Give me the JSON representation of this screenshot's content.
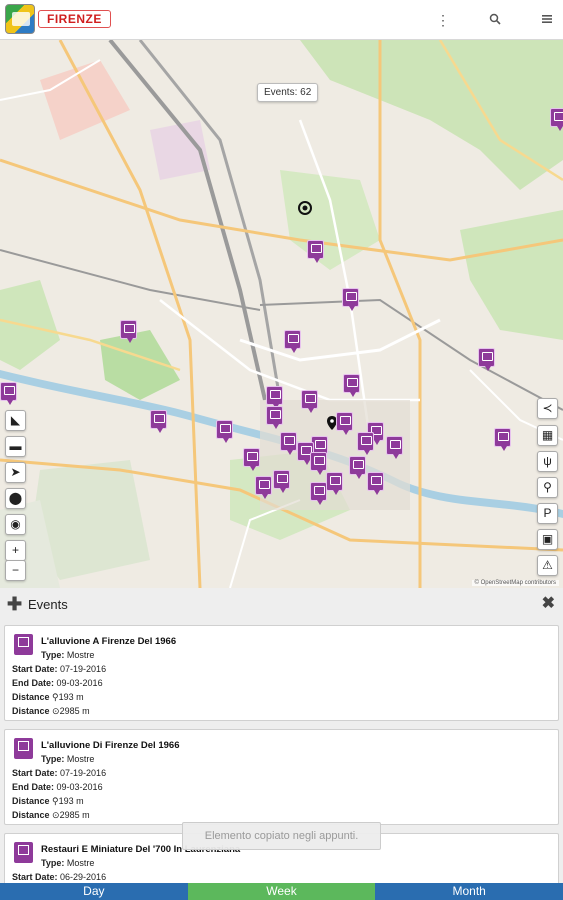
{
  "header": {
    "city": "FIRENZE",
    "icons": [
      "menu-dots-icon",
      "search-icon",
      "list-icon"
    ]
  },
  "map": {
    "events_label": "Events: 62",
    "attribution": "© OpenStreetMap contributors",
    "zoom_in": "+",
    "zoom_out": "−"
  },
  "panel": {
    "title": "Events",
    "cards": [
      {
        "title": "L'alluvione A Firenze Del 1966",
        "type_label": "Type:",
        "type": "Mostre",
        "start_label": "Start Date:",
        "start": "07-19-2016",
        "end_label": "End Date:",
        "end": "09-03-2016",
        "dist1_label": "Distance",
        "dist1": "193 m",
        "dist2_label": "Distance",
        "dist2": "2985 m"
      },
      {
        "title": "L'alluvione Di Firenze Del 1966",
        "type_label": "Type:",
        "type": "Mostre",
        "start_label": "Start Date:",
        "start": "07-19-2016",
        "end_label": "End Date:",
        "end": "09-03-2016",
        "dist1_label": "Distance",
        "dist1": "193 m",
        "dist2_label": "Distance",
        "dist2": "2985 m"
      },
      {
        "title": "Restauri E Miniature Del '700 In Laurenziana",
        "type_label": "Type:",
        "type": "Mostre",
        "start_label": "Start Date:",
        "start": "06-29-2016"
      }
    ]
  },
  "toast": "Elemento copiato negli appunti.",
  "tabs": {
    "day": "Day",
    "week": "Week",
    "month": "Month"
  },
  "colors": {
    "poi": "#8e3a9a",
    "tab_active": "#5cb85c",
    "tab": "#2a6db0",
    "city_badge": "#d01f1f"
  }
}
